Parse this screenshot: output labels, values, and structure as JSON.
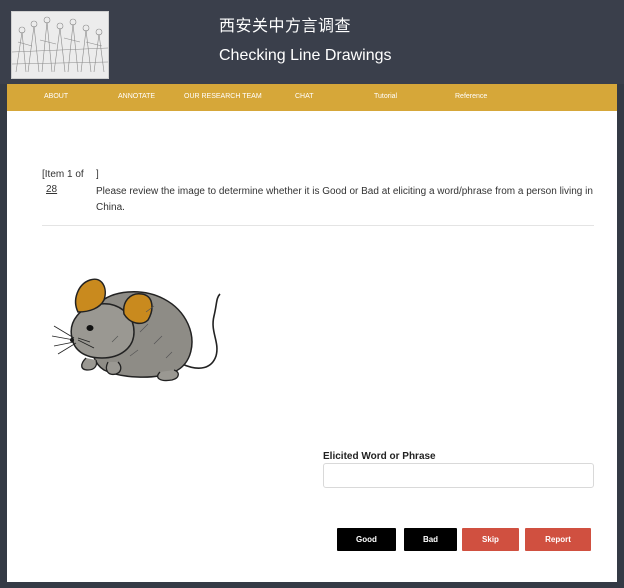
{
  "header": {
    "title_cn": "西安关中方言调查",
    "title_en": "Checking Line Drawings"
  },
  "nav": {
    "items": [
      "ABOUT",
      "ANNOTATE",
      "OUR RESEARCH TEAM",
      "CHAT",
      "Tutorial",
      "Reference"
    ]
  },
  "task": {
    "item_bracket_open": "[Item 1 of",
    "item_bracket_close": "]",
    "item_total": "28",
    "instruction": "Please review the image to determine whether it is Good or Bad at eliciting a word/phrase from a person living in China."
  },
  "form": {
    "label": "Elicited Word or Phrase",
    "value": "",
    "placeholder": ""
  },
  "buttons": {
    "good": "Good",
    "bad": "Bad",
    "skip": "Skip",
    "report": "Report"
  },
  "colors": {
    "header_bg": "#3a3f4b",
    "nav_bg": "#d6a739",
    "btn_dark": "#000000",
    "btn_red": "#d05040",
    "mouse_fur": "#8e8c86",
    "mouse_ear": "#c98a1e"
  },
  "icons": {
    "logo": "terracotta-warriors-sketch",
    "drawing": "mouse-line-drawing"
  }
}
